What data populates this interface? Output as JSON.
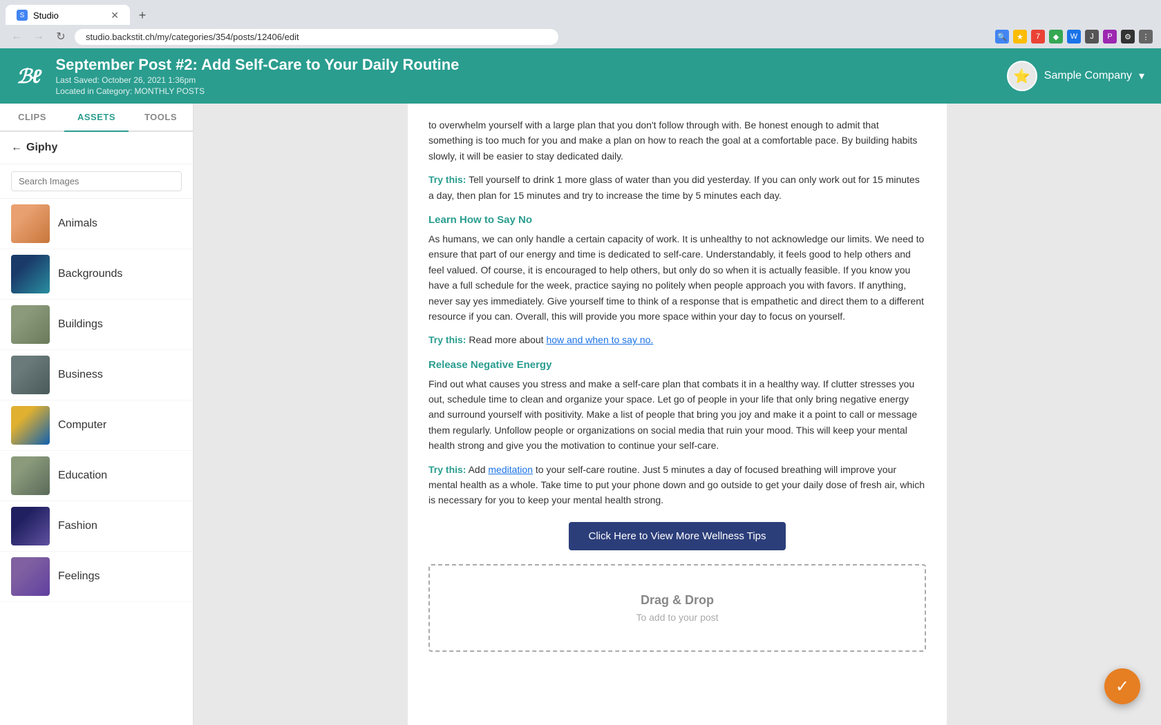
{
  "browser": {
    "tab_title": "Studio",
    "tab_favicon": "S",
    "url": "studio.backstit.ch/my/categories/354/posts/12406/edit",
    "new_tab_label": "+"
  },
  "header": {
    "logo": "ℬℓ",
    "title": "September Post #2: Add Self-Care to Your Daily Routine",
    "last_saved": "Last Saved: October 26, 2021 1:36pm",
    "location": "Located in Category: MONTHLY POSTS",
    "company_name": "Sample Company",
    "company_icon": "⭐"
  },
  "sidebar": {
    "tabs": [
      {
        "label": "CLIPS",
        "active": false
      },
      {
        "label": "ASSETS",
        "active": true
      },
      {
        "label": "TOOLS",
        "active": false
      }
    ],
    "back_label": "Giphy",
    "search_placeholder": "Search Images",
    "categories": [
      {
        "label": "Animals",
        "thumb_class": "thumb-animals"
      },
      {
        "label": "Backgrounds",
        "thumb_class": "thumb-backgrounds"
      },
      {
        "label": "Buildings",
        "thumb_class": "thumb-buildings"
      },
      {
        "label": "Business",
        "thumb_class": "thumb-business"
      },
      {
        "label": "Computer",
        "thumb_class": "thumb-computer"
      },
      {
        "label": "Education",
        "thumb_class": "thumb-education"
      },
      {
        "label": "Fashion",
        "thumb_class": "thumb-fashion"
      },
      {
        "label": "Feelings",
        "thumb_class": "thumb-feelings"
      }
    ]
  },
  "content": {
    "paragraphs": [
      "to overwhelm yourself with a large plan that you don't follow through with. Be honest enough to admit that something is too much for you and make a plan on how to reach the goal at a comfortable pace. By building habits slowly, it will be easier to stay dedicated daily.",
      "Tell yourself to drink 1 more glass of water than you did yesterday. If you can only work out for 15 minutes a day, then plan for 15 minutes and try to increase the time by 5 minutes each day.",
      "Learn How to Say No",
      "As humans, we can only handle a certain capacity of work. It is unhealthy to not acknowledge our limits. We need to ensure that part of our energy and time is dedicated to self-care. Understandably, it feels good to help others and feel valued. Of course, it is encouraged to help others, but only do so when it is actually feasible. If you know you have a full schedule for the week, practice saying no politely when people approach you with favors. If anything, never say yes immediately. Give yourself time to think of a response that is empathetic and direct them to a different resource if you can. Overall, this will provide you more space within your day to focus on yourself.",
      "Read more about",
      "how and when to say no.",
      "Release Negative Energy",
      "Find out what causes you stress and make a self-care plan that combats it in a healthy way. If clutter stresses you out, schedule time to clean and organize your space. Let go of people in your life that only bring negative energy and surround yourself with positivity. Make a list of people that bring you joy and make it a point to call or message them regularly. Unfollow people or organizations on social media that ruin your mood. This will keep your mental health strong and give you the motivation to continue your self-care.",
      "Add",
      "meditation",
      "to your self-care routine. Just 5 minutes a day of focused breathing will improve your mental health as a whole. Take time to put your phone down and go outside to get your daily dose of fresh air, which is necessary for you to keep your mental health strong.",
      "Click Here to View More Wellness Tips",
      "Drag & Drop",
      "To add to your post"
    ],
    "try_this_label": "Try this:",
    "wellness_btn": "Click Here to View More Wellness Tips",
    "drag_drop_title": "Drag & Drop",
    "drag_drop_subtitle": "To add to your post"
  },
  "fab": {
    "icon": "✓"
  }
}
